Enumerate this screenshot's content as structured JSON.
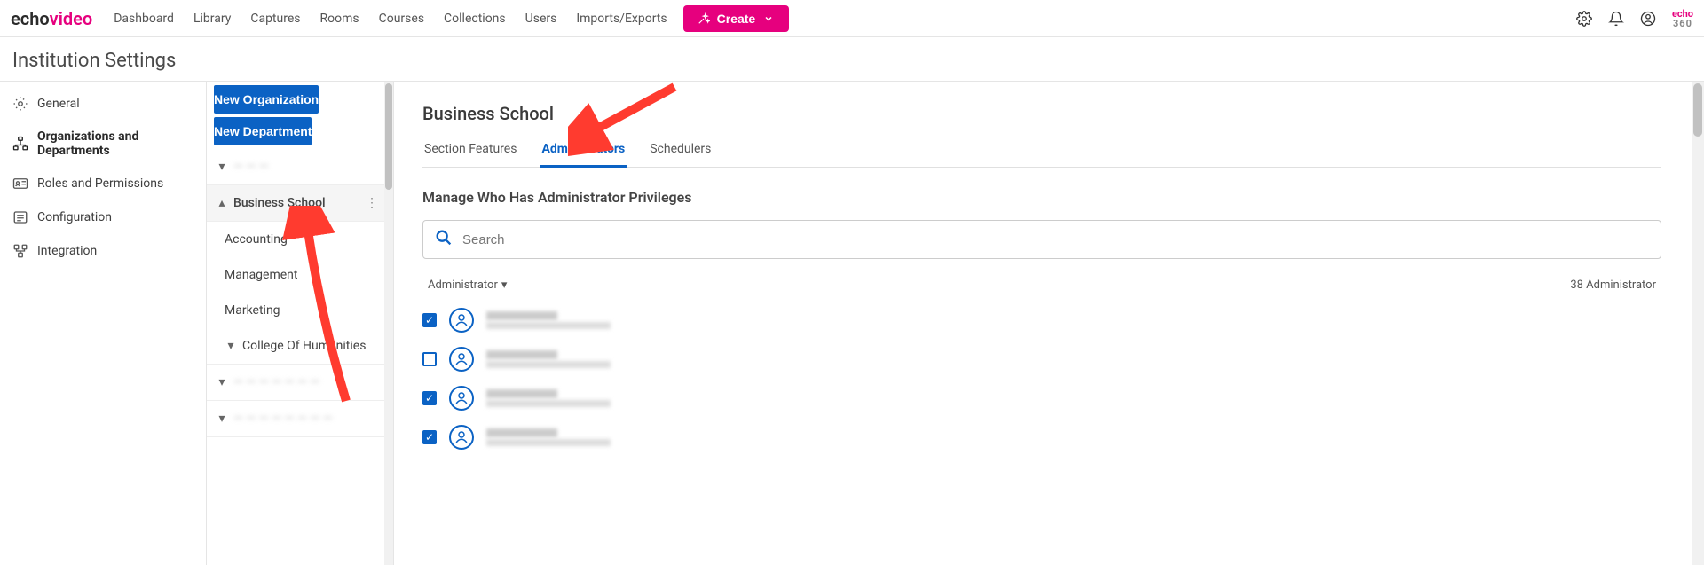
{
  "brand": {
    "part1": "echo",
    "part2": "video"
  },
  "nav": {
    "links": [
      "Dashboard",
      "Library",
      "Captures",
      "Rooms",
      "Courses",
      "Collections",
      "Users",
      "Imports/Exports"
    ],
    "create": "Create"
  },
  "miniLogo": {
    "line1": "echo",
    "line2": "360"
  },
  "page": {
    "title": "Institution Settings"
  },
  "sidebar": {
    "items": [
      {
        "label": "General"
      },
      {
        "label": "Organizations and Departments"
      },
      {
        "label": "Roles and Permissions"
      },
      {
        "label": "Configuration"
      },
      {
        "label": "Integration"
      }
    ],
    "activeIndex": 1
  },
  "orgButtons": {
    "newOrg": "New Organization",
    "newDept": "New Department"
  },
  "tree": {
    "root": {
      "label": "— — —"
    },
    "selected": {
      "label": "Business School"
    },
    "selectedChildren": [
      "Accounting",
      "Management",
      "Marketing"
    ],
    "other1": {
      "label": "College Of Humanities"
    },
    "blur1": "— — — — — — —",
    "blur2": "— — — — — — — —"
  },
  "content": {
    "heading": "Business School",
    "tabs": [
      "Section Features",
      "Administrators",
      "Schedulers"
    ],
    "activeTabIndex": 1,
    "sectionTitle": "Manage Who Has Administrator Privileges",
    "searchPlaceholder": "Search",
    "listHeader": {
      "sortLabel": "Administrator",
      "countLabel": "38 Administrator"
    },
    "rows": [
      {
        "checked": true
      },
      {
        "checked": false
      },
      {
        "checked": true
      },
      {
        "checked": true
      }
    ]
  }
}
